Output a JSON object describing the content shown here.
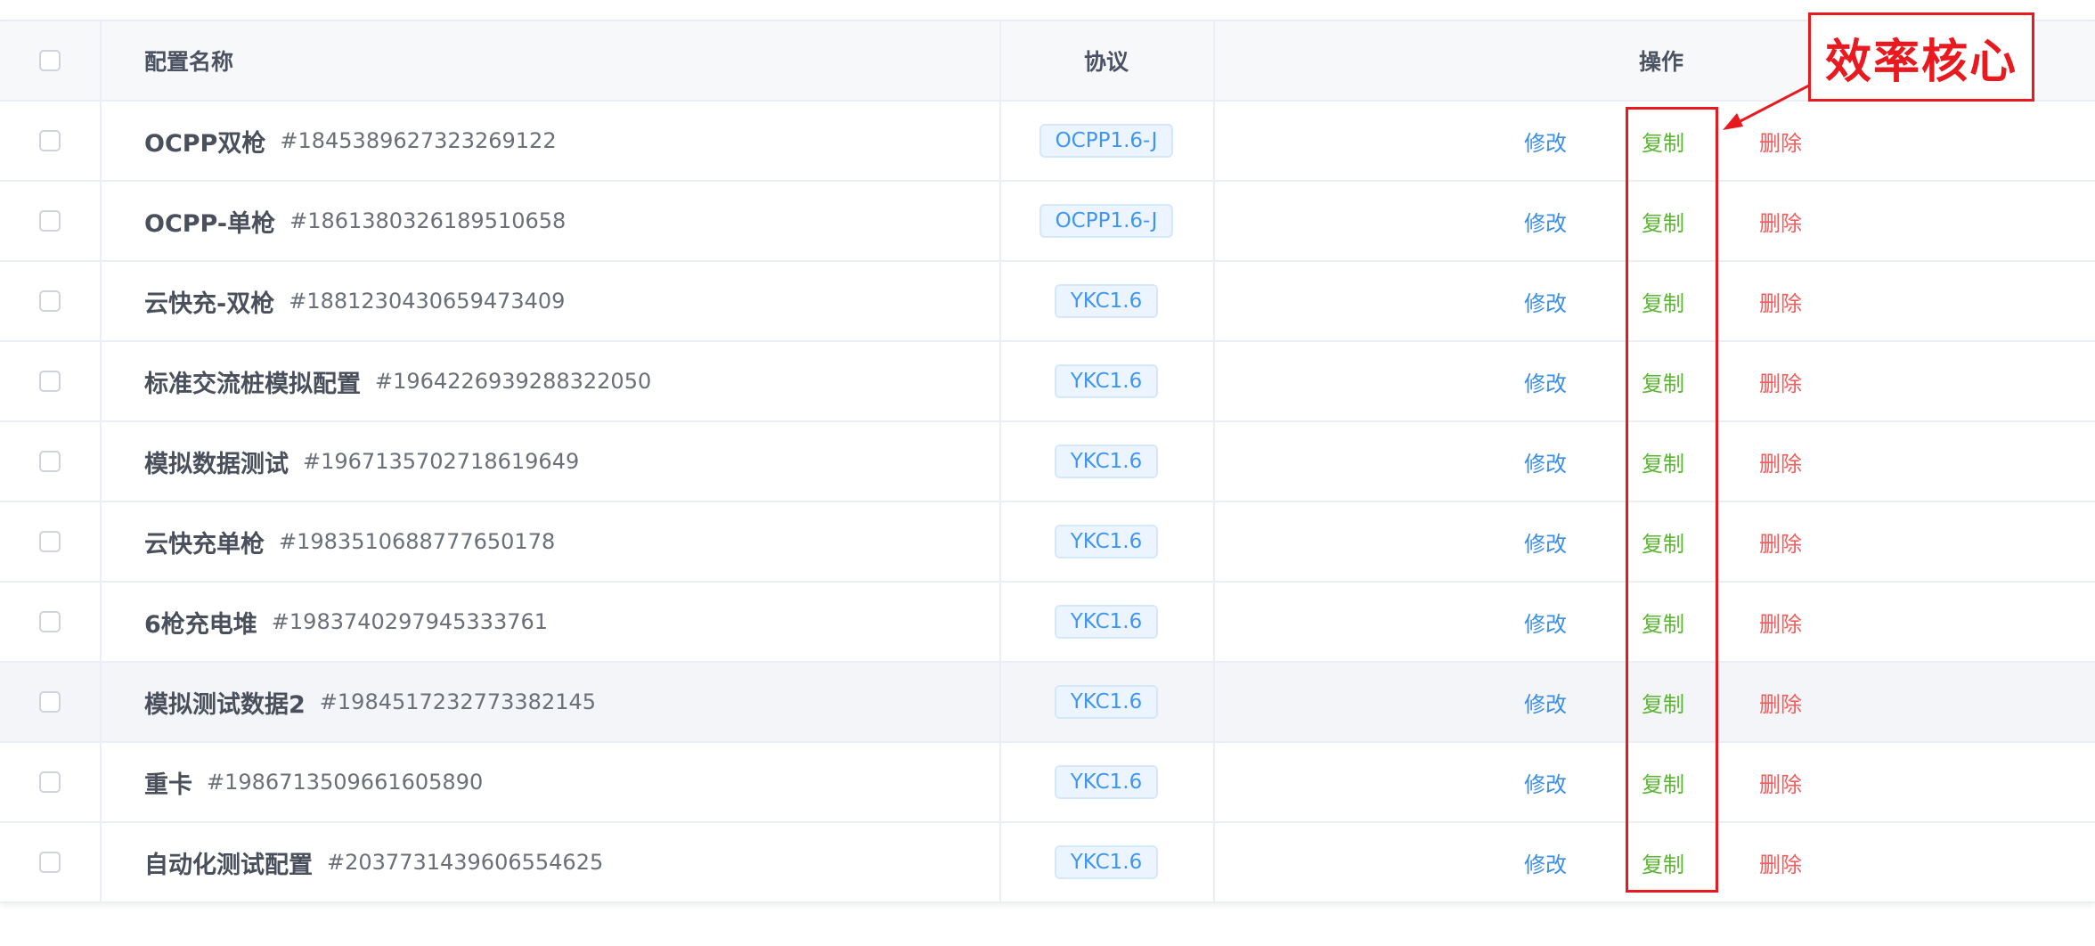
{
  "table": {
    "header": {
      "name_label": "配置名称",
      "protocol_label": "协议",
      "ops_label": "操作"
    },
    "action_labels": {
      "edit": "修改",
      "copy": "复制",
      "delete": "删除"
    },
    "rows": [
      {
        "name": "OCPP双枪",
        "id": "#1845389627323269122",
        "protocol": "OCPP1.6-J"
      },
      {
        "name": "OCPP-单枪",
        "id": "#1861380326189510658",
        "protocol": "OCPP1.6-J"
      },
      {
        "name": "云快充-双枪",
        "id": "#1881230430659473409",
        "protocol": "YKC1.6"
      },
      {
        "name": "标准交流桩模拟配置",
        "id": "#1964226939288322050",
        "protocol": "YKC1.6"
      },
      {
        "name": "模拟数据测试",
        "id": "#1967135702718619649",
        "protocol": "YKC1.6"
      },
      {
        "name": "云快充单枪",
        "id": "#1983510688777650178",
        "protocol": "YKC1.6"
      },
      {
        "name": "6枪充电堆",
        "id": "#1983740297945333761",
        "protocol": "YKC1.6"
      },
      {
        "name": "模拟测试数据2",
        "id": "#1984517232773382145",
        "protocol": "YKC1.6"
      },
      {
        "name": "重卡",
        "id": "#1986713509661605890",
        "protocol": "YKC1.6"
      },
      {
        "name": "自动化测试配置",
        "id": "#2037731439606554625",
        "protocol": "YKC1.6"
      }
    ]
  },
  "annotation": {
    "callout_text": "效率核心",
    "color": "#e8191f"
  },
  "colors": {
    "edit": "#3a8ee6",
    "copy": "#5ab432",
    "delete": "#ef5d5d",
    "tag_text": "#3f96f0",
    "tag_bg": "#ecf5ff"
  }
}
